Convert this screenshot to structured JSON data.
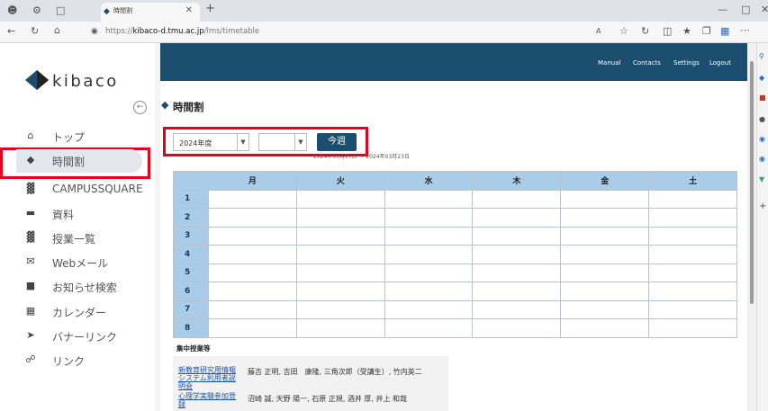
{
  "browser": {
    "tab_title": "時間割",
    "url_prefix": "https://",
    "url_host": "kibaco-d.tmu.ac.jp",
    "url_path": "/lms/timetable"
  },
  "header": {
    "links": [
      "Manual",
      "Contacts",
      "Settings",
      "Logout"
    ]
  },
  "sidebar": {
    "logo_text": "kibaco",
    "items": [
      {
        "label": "トップ",
        "icon": "home-icon"
      },
      {
        "label": "時間割",
        "icon": "graduation-cap-icon"
      },
      {
        "label": "CAMPUSSQUARE",
        "icon": "building-icon"
      },
      {
        "label": "資料",
        "icon": "folder-icon"
      },
      {
        "label": "授業一覧",
        "icon": "building-icon"
      },
      {
        "label": "Webメール",
        "icon": "mail-icon"
      },
      {
        "label": "お知らせ検索",
        "icon": "comment-icon"
      },
      {
        "label": "カレンダー",
        "icon": "calendar-icon"
      },
      {
        "label": "バナーリンク",
        "icon": "share-icon"
      },
      {
        "label": "リンク",
        "icon": "link-icon"
      }
    ]
  },
  "main": {
    "title": "時間割",
    "year_select": "2024年度",
    "term_select": "",
    "this_week_button": "今週",
    "range_text": "2024年03月17日 ～ 2024年03月23日",
    "days": [
      "月",
      "火",
      "水",
      "木",
      "金",
      "土"
    ],
    "periods": [
      "1",
      "2",
      "3",
      "4",
      "5",
      "6",
      "7",
      "8"
    ],
    "intensive_title": "集中授業等",
    "intensive": [
      {
        "course": "新教育研究用情報システム利用者説明会",
        "course_lines": [
          "新教育研究用情報",
          "システム利用者説",
          "明会"
        ],
        "instructors": "藤吉 正明, 吉田　康隆, 三角次郎（受講生）, 竹内英二"
      },
      {
        "course": "心理学実験参加登録",
        "course_lines": [
          "心理学実験参加登",
          "録"
        ],
        "instructors": "沼崎 誠, 天野 陽一, 石原 正規, 酒井 厚, 井上 和哉"
      }
    ]
  },
  "colors": {
    "brand": "#1a4d6e",
    "table_header": "#a9cde8",
    "highlight": "#e8001c",
    "active_nav": "#e1e7ed"
  }
}
